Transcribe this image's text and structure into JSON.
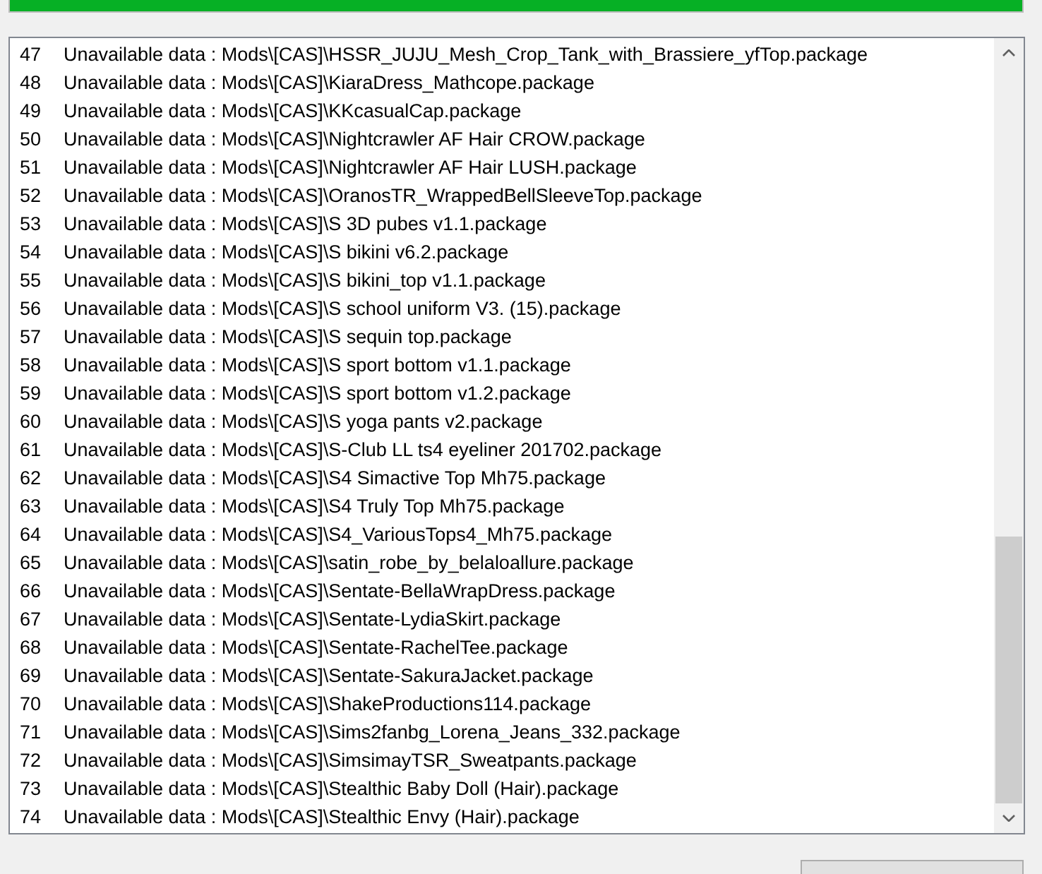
{
  "progress": {
    "level": 1
  },
  "log": {
    "rows": [
      {
        "number": "47",
        "text": "Unavailable data : Mods\\[CAS]\\HSSR_JUJU_Mesh_Crop_Tank_with_Brassiere_yfTop.package"
      },
      {
        "number": "48",
        "text": "Unavailable data : Mods\\[CAS]\\KiaraDress_Mathcope.package"
      },
      {
        "number": "49",
        "text": "Unavailable data : Mods\\[CAS]\\KKcasualCap.package"
      },
      {
        "number": "50",
        "text": "Unavailable data : Mods\\[CAS]\\Nightcrawler AF Hair CROW.package"
      },
      {
        "number": "51",
        "text": "Unavailable data : Mods\\[CAS]\\Nightcrawler AF Hair LUSH.package"
      },
      {
        "number": "52",
        "text": "Unavailable data : Mods\\[CAS]\\OranosTR_WrappedBellSleeveTop.package"
      },
      {
        "number": "53",
        "text": "Unavailable data : Mods\\[CAS]\\S 3D pubes v1.1.package"
      },
      {
        "number": "54",
        "text": "Unavailable data : Mods\\[CAS]\\S bikini v6.2.package"
      },
      {
        "number": "55",
        "text": "Unavailable data : Mods\\[CAS]\\S bikini_top v1.1.package"
      },
      {
        "number": "56",
        "text": "Unavailable data : Mods\\[CAS]\\S school uniform V3. (15).package"
      },
      {
        "number": "57",
        "text": "Unavailable data : Mods\\[CAS]\\S sequin top.package"
      },
      {
        "number": "58",
        "text": "Unavailable data : Mods\\[CAS]\\S sport bottom v1.1.package"
      },
      {
        "number": "59",
        "text": "Unavailable data : Mods\\[CAS]\\S sport bottom v1.2.package"
      },
      {
        "number": "60",
        "text": "Unavailable data : Mods\\[CAS]\\S yoga pants v2.package"
      },
      {
        "number": "61",
        "text": "Unavailable data : Mods\\[CAS]\\S-Club LL ts4 eyeliner 201702.package"
      },
      {
        "number": "62",
        "text": "Unavailable data : Mods\\[CAS]\\S4 Simactive Top Mh75.package"
      },
      {
        "number": "63",
        "text": "Unavailable data : Mods\\[CAS]\\S4 Truly Top Mh75.package"
      },
      {
        "number": "64",
        "text": "Unavailable data : Mods\\[CAS]\\S4_VariousTops4_Mh75.package"
      },
      {
        "number": "65",
        "text": "Unavailable data : Mods\\[CAS]\\satin_robe_by_belaloallure.package"
      },
      {
        "number": "66",
        "text": "Unavailable data : Mods\\[CAS]\\Sentate-BellaWrapDress.package"
      },
      {
        "number": "67",
        "text": "Unavailable data : Mods\\[CAS]\\Sentate-LydiaSkirt.package"
      },
      {
        "number": "68",
        "text": "Unavailable data : Mods\\[CAS]\\Sentate-RachelTee.package"
      },
      {
        "number": "69",
        "text": "Unavailable data : Mods\\[CAS]\\Sentate-SakuraJacket.package"
      },
      {
        "number": "70",
        "text": "Unavailable data : Mods\\[CAS]\\ShakeProductions114.package"
      },
      {
        "number": "71",
        "text": "Unavailable data : Mods\\[CAS]\\Sims2fanbg_Lorena_Jeans_332.package"
      },
      {
        "number": "72",
        "text": "Unavailable data : Mods\\[CAS]\\SimsimayTSR_Sweatpants.package"
      },
      {
        "number": "73",
        "text": "Unavailable data : Mods\\[CAS]\\Stealthic Baby Doll (Hair).package"
      },
      {
        "number": "74",
        "text": "Unavailable data : Mods\\[CAS]\\Stealthic Envy (Hair).package"
      }
    ]
  }
}
